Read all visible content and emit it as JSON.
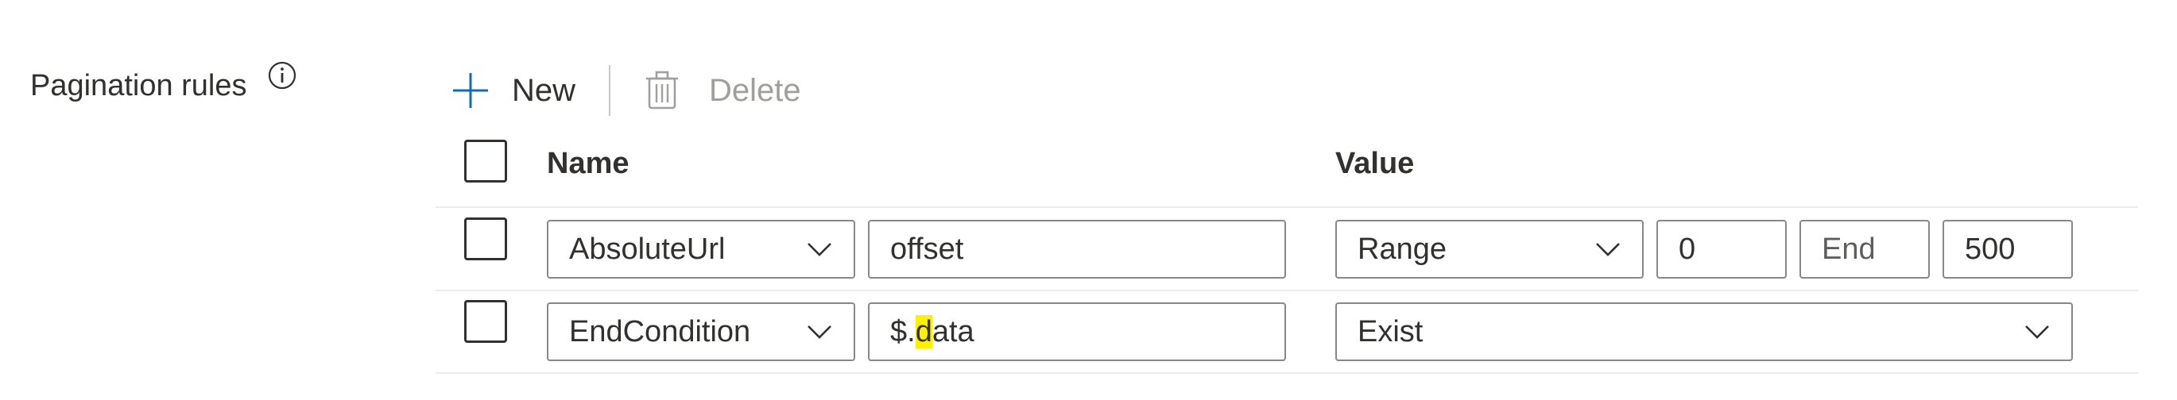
{
  "section": {
    "label": "Pagination rules",
    "info_icon": "info-icon"
  },
  "toolbar": {
    "new_label": "New",
    "delete_label": "Delete",
    "new_icon": "plus-icon",
    "delete_icon": "trash-icon"
  },
  "table": {
    "headers": {
      "name": "Name",
      "value": "Value"
    },
    "rows": [
      {
        "name_type": "AbsoluteUrl",
        "name_value": "offset",
        "value_type": "Range",
        "range_start": "0",
        "range_end_placeholder": "End",
        "range_step": "500"
      },
      {
        "name_type": "EndCondition",
        "name_value_prefix": "$.",
        "name_value_highlight": "d",
        "name_value_suffix": "ata",
        "value_type": "Exist"
      }
    ]
  },
  "colors": {
    "accent": "#0f6cbd",
    "highlight": "#fff100",
    "disabled": "#a19f9d",
    "border": "#8a8886"
  }
}
